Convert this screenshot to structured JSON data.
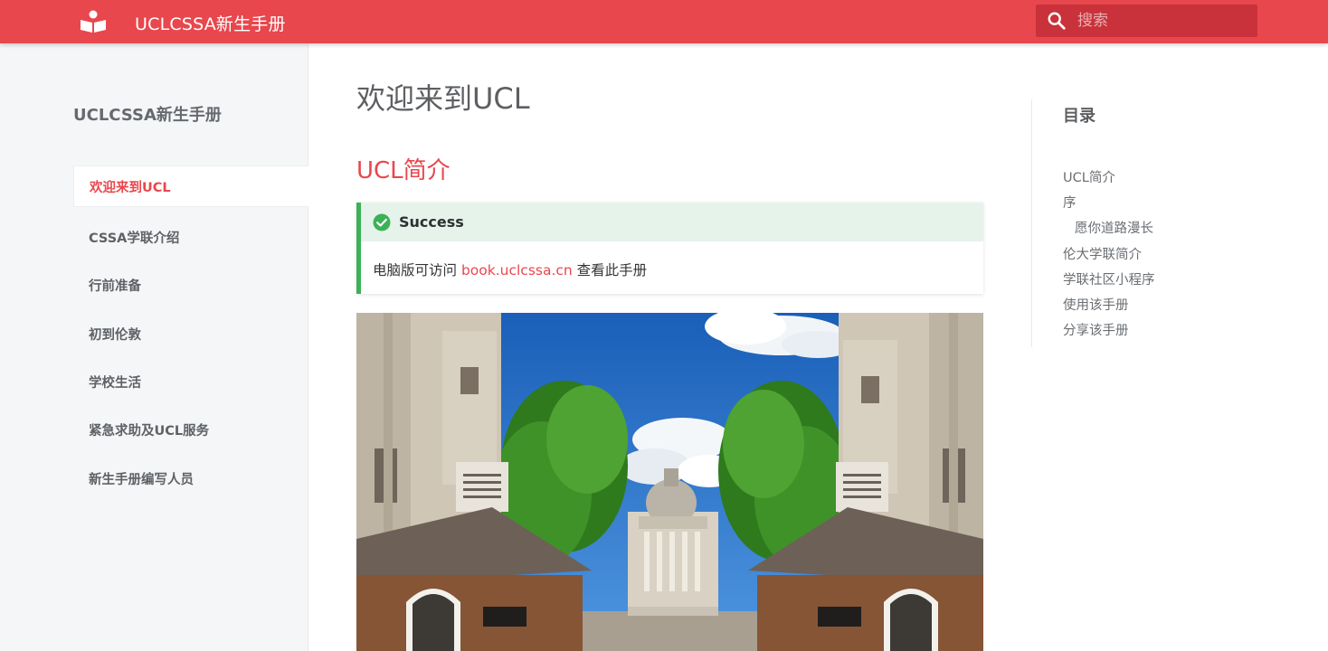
{
  "header": {
    "site_title": "UCLCSSA新生手册",
    "logo_icon": "open-book-icon",
    "search": {
      "placeholder": "搜索",
      "icon": "search-icon"
    },
    "brand_color": "#e8474d"
  },
  "sidebar": {
    "title": "UCLCSSA新生手册",
    "items": [
      {
        "label": "欢迎来到UCL",
        "active": true
      },
      {
        "label": "CSSA学联介绍",
        "active": false
      },
      {
        "label": "行前准备",
        "active": false
      },
      {
        "label": "初到伦敦",
        "active": false
      },
      {
        "label": "学校生活",
        "active": false
      },
      {
        "label": "紧急求助及UCL服务",
        "active": false
      },
      {
        "label": "新生手册编写人员",
        "active": false
      }
    ]
  },
  "main": {
    "page_title": "欢迎来到UCL",
    "section_title": "UCL简介",
    "callout": {
      "type": "success",
      "icon": "check-circle-icon",
      "title": "Success",
      "body_prefix": "电脑版可访问 ",
      "link_text": "book.uclcssa.cn",
      "body_suffix": " 查看此手册",
      "accent_color": "#3db157"
    },
    "hero_image": "ucl-portico-campus-photo"
  },
  "toc": {
    "title": "目录",
    "items": [
      {
        "label": "UCL简介",
        "level": 1
      },
      {
        "label": "序",
        "level": 1
      },
      {
        "label": "愿你道路漫长",
        "level": 2
      },
      {
        "label": "伦大学联简介",
        "level": 1
      },
      {
        "label": "学联社区小程序",
        "level": 1
      },
      {
        "label": "使用该手册",
        "level": 1
      },
      {
        "label": "分享该手册",
        "level": 1
      }
    ]
  }
}
